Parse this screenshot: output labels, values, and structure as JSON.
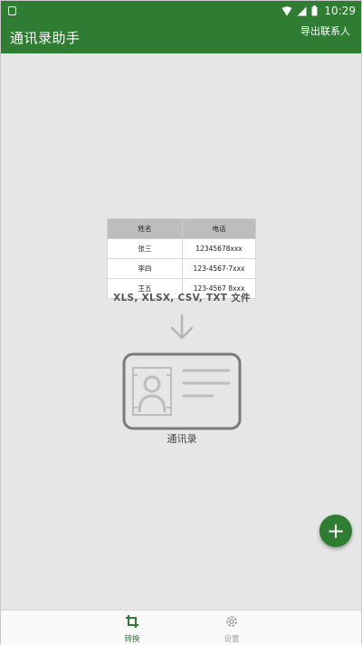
{
  "status_bar": {
    "time": "10:29",
    "icons": [
      "notification-icon",
      "wifi-icon",
      "signal-icon",
      "battery-icon"
    ]
  },
  "app_bar": {
    "title": "通讯录助手",
    "action_label": "导出联系人"
  },
  "main": {
    "table": {
      "headers": [
        "姓名",
        "电话"
      ],
      "rows": [
        [
          "张三",
          "12345678xxx"
        ],
        [
          "李四",
          "123-4567-7xxx"
        ],
        [
          "王五",
          "123-4567 8xxx"
        ]
      ]
    },
    "formats_text": "XLS,  XLSX,  CSV,  TXT 文件",
    "contacts_label": "通讯录"
  },
  "fab": {
    "icon": "add-icon",
    "label": "+"
  },
  "bottom_nav": {
    "items": [
      {
        "label": "转换",
        "icon": "crop-icon",
        "active": true
      },
      {
        "label": "设置",
        "icon": "gear-icon",
        "active": false
      }
    ]
  },
  "colors": {
    "primary": "#2e7d32",
    "background": "#e6e6e6",
    "inactive": "#9e9e9e"
  }
}
